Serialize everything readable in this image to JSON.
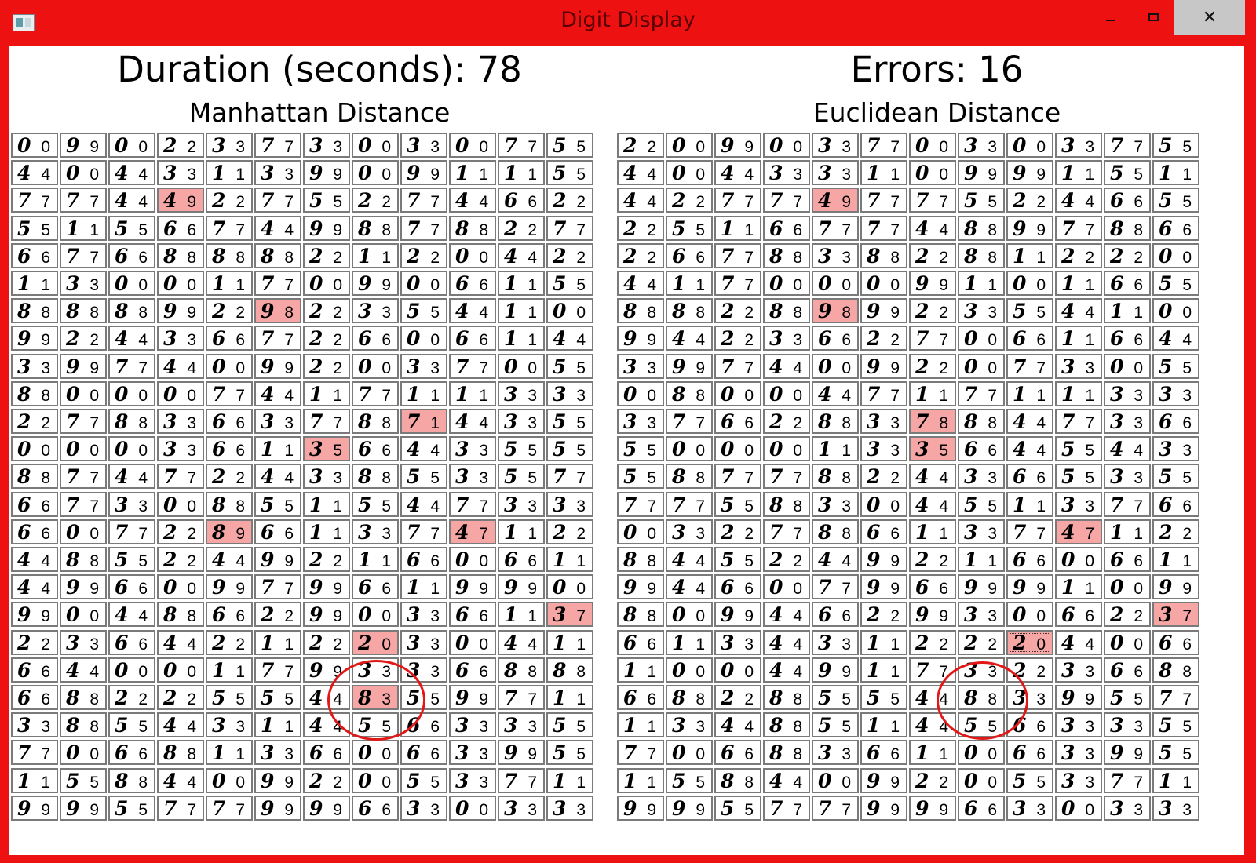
{
  "window": {
    "title": "Digit Display",
    "icon": "app-icon",
    "close_label": "✕",
    "frame_color": "#ee1111",
    "error_cell_color": "#f7a6a6",
    "circle_color": "#e01818"
  },
  "header": {
    "duration": "Duration (seconds): 78",
    "errors": "Errors: 16"
  },
  "panels": [
    {
      "title": "Manhattan Distance",
      "rows": [
        [
          "00",
          "99",
          "00",
          "22",
          "33",
          "77",
          "33",
          "00",
          "33",
          "00",
          "77",
          "55"
        ],
        [
          "44",
          "00",
          "44",
          "33",
          "11",
          "33",
          "99",
          "00",
          "99",
          "11",
          "11",
          "55"
        ],
        [
          "77",
          "77",
          "44",
          "49",
          "22",
          "77",
          "55",
          "22",
          "77",
          "44",
          "66",
          "22"
        ],
        [
          "55",
          "11",
          "55",
          "66",
          "77",
          "44",
          "99",
          "88",
          "77",
          "88",
          "22",
          "77"
        ],
        [
          "66",
          "77",
          "66",
          "88",
          "88",
          "88",
          "22",
          "11",
          "22",
          "00",
          "44",
          "22"
        ],
        [
          "11",
          "33",
          "00",
          "00",
          "11",
          "77",
          "00",
          "99",
          "00",
          "66",
          "11",
          "55"
        ],
        [
          "88",
          "88",
          "88",
          "99",
          "22",
          "98",
          "22",
          "33",
          "55",
          "44",
          "11",
          "00"
        ],
        [
          "99",
          "22",
          "44",
          "33",
          "66",
          "77",
          "22",
          "66",
          "00",
          "66",
          "11",
          "44"
        ],
        [
          "33",
          "99",
          "77",
          "44",
          "00",
          "99",
          "22",
          "00",
          "33",
          "77",
          "00",
          "55"
        ],
        [
          "88",
          "00",
          "00",
          "00",
          "77",
          "44",
          "11",
          "77",
          "11",
          "11",
          "33",
          "33"
        ],
        [
          "22",
          "77",
          "88",
          "33",
          "66",
          "33",
          "77",
          "88",
          "71",
          "44",
          "33",
          "55"
        ],
        [
          "00",
          "00",
          "00",
          "33",
          "66",
          "11",
          "35",
          "66",
          "44",
          "33",
          "55",
          "55"
        ],
        [
          "88",
          "77",
          "44",
          "77",
          "22",
          "44",
          "33",
          "88",
          "55",
          "33",
          "55",
          "77"
        ],
        [
          "66",
          "77",
          "33",
          "00",
          "88",
          "55",
          "11",
          "55",
          "44",
          "77",
          "33",
          "33"
        ],
        [
          "66",
          "00",
          "77",
          "22",
          "89",
          "66",
          "11",
          "33",
          "77",
          "47",
          "11",
          "22"
        ],
        [
          "44",
          "88",
          "55",
          "22",
          "44",
          "99",
          "22",
          "11",
          "66",
          "00",
          "66",
          "11"
        ],
        [
          "44",
          "99",
          "66",
          "00",
          "99",
          "77",
          "99",
          "66",
          "11",
          "99",
          "99",
          "00"
        ],
        [
          "99",
          "00",
          "44",
          "88",
          "66",
          "22",
          "99",
          "00",
          "33",
          "66",
          "11",
          "37"
        ],
        [
          "22",
          "33",
          "66",
          "44",
          "22",
          "11",
          "22",
          "20",
          "33",
          "00",
          "44",
          "11"
        ],
        [
          "66",
          "44",
          "00",
          "00",
          "11",
          "77",
          "99",
          "33",
          "33",
          "66",
          "88",
          "88"
        ],
        [
          "66",
          "88",
          "22",
          "22",
          "55",
          "55",
          "44",
          "83",
          "55",
          "99",
          "77",
          "11"
        ],
        [
          "33",
          "88",
          "55",
          "44",
          "33",
          "11",
          "44",
          "55",
          "66",
          "33",
          "33",
          "55"
        ],
        [
          "77",
          "00",
          "66",
          "88",
          "11",
          "33",
          "66",
          "00",
          "66",
          "33",
          "99",
          "55"
        ],
        [
          "11",
          "55",
          "88",
          "44",
          "00",
          "99",
          "22",
          "00",
          "55",
          "33",
          "77",
          "11"
        ],
        [
          "99",
          "99",
          "55",
          "77",
          "77",
          "99",
          "99",
          "66",
          "33",
          "00",
          "33",
          "33"
        ]
      ],
      "errors": [
        [
          2,
          3
        ],
        [
          6,
          5
        ],
        [
          10,
          8
        ],
        [
          11,
          6
        ],
        [
          14,
          4
        ],
        [
          14,
          9
        ],
        [
          17,
          11
        ],
        [
          18,
          7
        ],
        [
          20,
          7
        ]
      ],
      "selected": []
    },
    {
      "title": "Euclidean Distance",
      "rows": [
        [
          "22",
          "00",
          "99",
          "00",
          "33",
          "77",
          "00",
          "33",
          "00",
          "33",
          "77",
          "55"
        ],
        [
          "44",
          "00",
          "44",
          "33",
          "33",
          "11",
          "00",
          "99",
          "99",
          "11",
          "55",
          "11"
        ],
        [
          "44",
          "22",
          "77",
          "77",
          "49",
          "77",
          "77",
          "55",
          "22",
          "44",
          "66",
          "55"
        ],
        [
          "22",
          "55",
          "11",
          "66",
          "77",
          "77",
          "44",
          "88",
          "99",
          "77",
          "88",
          "66"
        ],
        [
          "22",
          "66",
          "77",
          "88",
          "33",
          "88",
          "22",
          "88",
          "11",
          "22",
          "22",
          "00"
        ],
        [
          "44",
          "11",
          "77",
          "00",
          "00",
          "00",
          "99",
          "11",
          "00",
          "11",
          "66",
          "55"
        ],
        [
          "88",
          "88",
          "22",
          "88",
          "98",
          "99",
          "22",
          "33",
          "55",
          "44",
          "11",
          "00"
        ],
        [
          "99",
          "44",
          "22",
          "33",
          "66",
          "22",
          "77",
          "00",
          "66",
          "11",
          "66",
          "44"
        ],
        [
          "33",
          "99",
          "77",
          "44",
          "00",
          "99",
          "22",
          "00",
          "77",
          "33",
          "00",
          "55"
        ],
        [
          "00",
          "88",
          "00",
          "00",
          "44",
          "77",
          "11",
          "77",
          "11",
          "11",
          "33",
          "33"
        ],
        [
          "33",
          "77",
          "66",
          "22",
          "88",
          "33",
          "78",
          "88",
          "44",
          "77",
          "33",
          "66"
        ],
        [
          "55",
          "00",
          "00",
          "00",
          "11",
          "33",
          "35",
          "66",
          "44",
          "55",
          "44",
          "33"
        ],
        [
          "55",
          "88",
          "77",
          "77",
          "88",
          "22",
          "44",
          "33",
          "66",
          "55",
          "33",
          "55"
        ],
        [
          "77",
          "77",
          "55",
          "88",
          "33",
          "00",
          "44",
          "55",
          "11",
          "33",
          "77",
          "66"
        ],
        [
          "00",
          "33",
          "22",
          "77",
          "88",
          "66",
          "11",
          "33",
          "77",
          "47",
          "11",
          "22"
        ],
        [
          "88",
          "44",
          "55",
          "22",
          "44",
          "99",
          "22",
          "11",
          "66",
          "00",
          "66",
          "11"
        ],
        [
          "99",
          "44",
          "66",
          "00",
          "77",
          "99",
          "66",
          "99",
          "99",
          "11",
          "00",
          "99"
        ],
        [
          "88",
          "00",
          "99",
          "44",
          "66",
          "22",
          "99",
          "33",
          "00",
          "66",
          "22",
          "37"
        ],
        [
          "66",
          "11",
          "33",
          "44",
          "33",
          "11",
          "22",
          "22",
          "20",
          "44",
          "00",
          "66"
        ],
        [
          "11",
          "00",
          "00",
          "44",
          "99",
          "11",
          "77",
          "33",
          "22",
          "33",
          "66",
          "88"
        ],
        [
          "66",
          "88",
          "22",
          "88",
          "55",
          "55",
          "44",
          "88",
          "33",
          "99",
          "55",
          "77"
        ],
        [
          "11",
          "33",
          "44",
          "88",
          "55",
          "11",
          "44",
          "55",
          "66",
          "33",
          "33",
          "55"
        ],
        [
          "77",
          "00",
          "66",
          "88",
          "33",
          "66",
          "11",
          "00",
          "66",
          "33",
          "99",
          "55"
        ],
        [
          "11",
          "55",
          "88",
          "44",
          "00",
          "99",
          "22",
          "00",
          "55",
          "33",
          "77",
          "11"
        ],
        [
          "99",
          "99",
          "55",
          "77",
          "77",
          "99",
          "99",
          "66",
          "33",
          "00",
          "33",
          "33"
        ]
      ],
      "errors": [
        [
          2,
          4
        ],
        [
          6,
          4
        ],
        [
          10,
          6
        ],
        [
          11,
          6
        ],
        [
          14,
          9
        ],
        [
          17,
          11
        ],
        [
          18,
          8
        ]
      ],
      "selected": [
        [
          18,
          8
        ]
      ]
    }
  ]
}
